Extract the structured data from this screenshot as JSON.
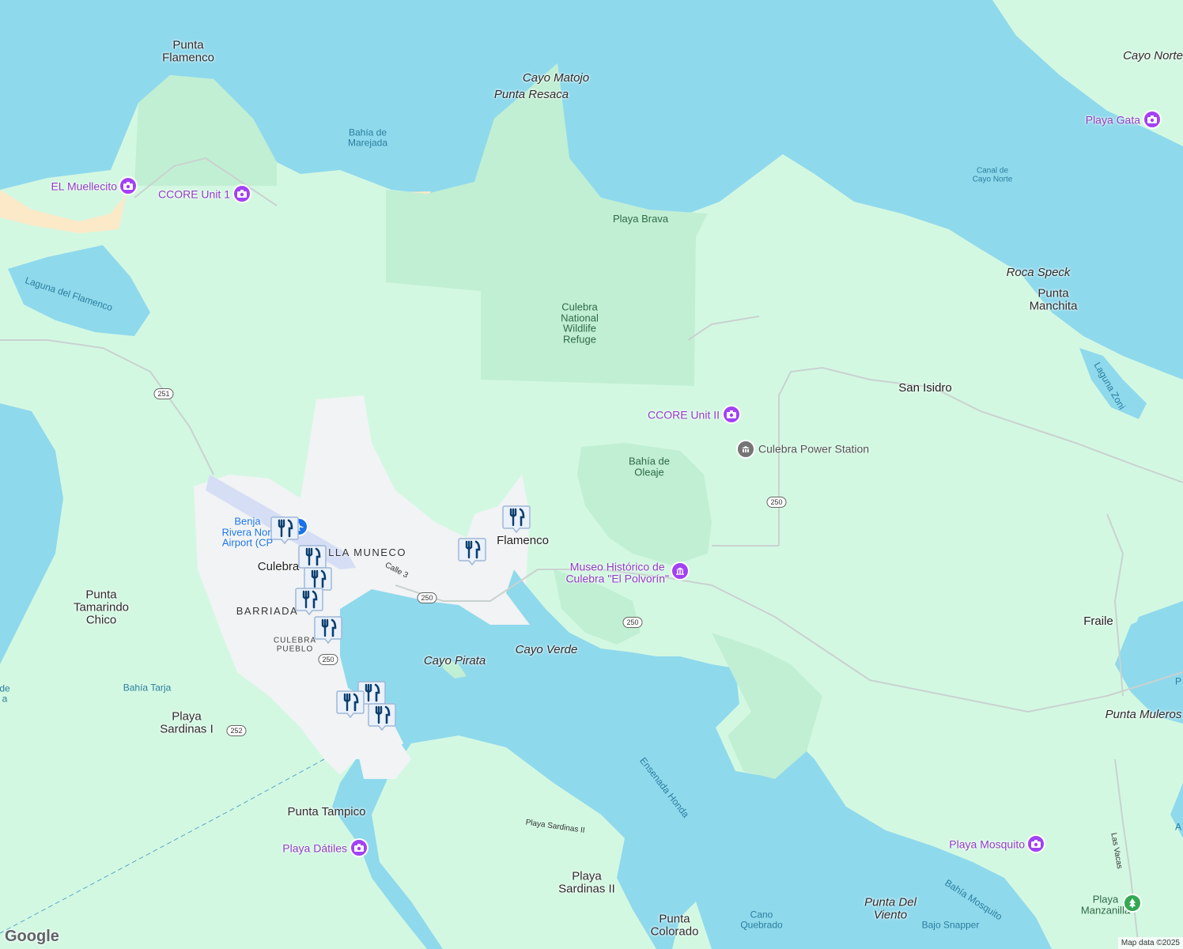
{
  "map": {
    "places": [
      {
        "id": "punta-flamenco",
        "text": "Punta\nFlamenco",
        "style": "place"
      },
      {
        "id": "cayo-matojo",
        "text": "Cayo Matojo",
        "style": "place-i"
      },
      {
        "id": "punta-resaca",
        "text": "Punta Resaca",
        "style": "place-i"
      },
      {
        "id": "cayo-norte",
        "text": "Cayo Norte",
        "style": "place-i"
      },
      {
        "id": "roca-speck",
        "text": "Roca Speck",
        "style": "place-i"
      },
      {
        "id": "punta-manchita",
        "text": "Punta\nManchita",
        "style": "place"
      },
      {
        "id": "san-isidro",
        "text": "San Isidro",
        "style": "town"
      },
      {
        "id": "flamenco",
        "text": "Flamenco",
        "style": "town"
      },
      {
        "id": "culebra",
        "text": "Culebra",
        "style": "town"
      },
      {
        "id": "villa-muneco",
        "text": "ILLA MUNECO",
        "style": "hood"
      },
      {
        "id": "barriada",
        "text": "BARRIADA",
        "style": "hood"
      },
      {
        "id": "culebra-pueblo",
        "text": "CULEBRA\nPUEBLO",
        "style": "hood-sm"
      },
      {
        "id": "punta-tamarindo",
        "text": "Punta\nTamarindo\nChico",
        "style": "place"
      },
      {
        "id": "playa-sardinas-i",
        "text": "Playa\nSardinas I",
        "style": "place"
      },
      {
        "id": "cayo-pirata",
        "text": "Cayo Pirata",
        "style": "place-i"
      },
      {
        "id": "cayo-verde",
        "text": "Cayo Verde",
        "style": "place-i"
      },
      {
        "id": "fraile",
        "text": "Fraile",
        "style": "town"
      },
      {
        "id": "punta-muleros",
        "text": "Punta Muleros",
        "style": "place-i"
      },
      {
        "id": "punta-tampico",
        "text": "Punta Tampico",
        "style": "place"
      },
      {
        "id": "playa-sardinas-ii",
        "text": "Playa\nSardinas II",
        "style": "place"
      },
      {
        "id": "punta-colorado",
        "text": "Punta\nColorado",
        "style": "place"
      },
      {
        "id": "punta-del-viento",
        "text": "Punta Del\nViento",
        "style": "place-i"
      },
      {
        "id": "playa-manzanilla",
        "text": "Playa\nManzanilla",
        "style": "park"
      }
    ],
    "water_labels": [
      {
        "id": "bahia-marejada",
        "text": "Bahía de\nMarejada",
        "style": "water"
      },
      {
        "id": "canal-cayo-norte",
        "text": "Canal de\nCayo Norte",
        "style": "water-sm"
      },
      {
        "id": "laguna-flamenco",
        "text": "Laguna del Flamenco",
        "style": "water"
      },
      {
        "id": "laguna-zoni",
        "text": "Laguna Zoni",
        "style": "water"
      },
      {
        "id": "bahia-tarja",
        "text": "Bahía Tarja",
        "style": "water"
      },
      {
        "id": "ensenada-honda",
        "text": "Ensenada Honda",
        "style": "water"
      },
      {
        "id": "bahia-mosquito",
        "text": "Bahía Mosquito",
        "style": "water"
      },
      {
        "id": "bajo-snapper",
        "text": "Bajo Snapper",
        "style": "water"
      },
      {
        "id": "cano-quebrado",
        "text": "Cano\nQuebrado",
        "style": "water"
      },
      {
        "id": "left-de",
        "text": "de\na",
        "style": "water"
      },
      {
        "id": "right-a",
        "text": "A",
        "style": "water"
      },
      {
        "id": "right-p",
        "text": "P",
        "style": "water"
      }
    ],
    "park_labels": [
      {
        "id": "playa-brava",
        "text": "Playa Brava",
        "style": "park"
      },
      {
        "id": "culebra-nwr",
        "text": "Culebra\nNational\nWildlife\nRefuge",
        "style": "park"
      },
      {
        "id": "bahia-oleaje",
        "text": "Bahía de\nOleaje",
        "style": "park"
      }
    ],
    "street_labels": [
      {
        "id": "calle-3",
        "text": "Calle 3"
      },
      {
        "id": "playa-sardinas-ii-road",
        "text": "Playa Sardinas II"
      },
      {
        "id": "las-vacas",
        "text": "Las Vacas"
      }
    ],
    "route_shields": [
      {
        "id": "r251",
        "text": "251"
      },
      {
        "id": "r250a",
        "text": "250"
      },
      {
        "id": "r250b",
        "text": "250"
      },
      {
        "id": "r250c",
        "text": "250"
      },
      {
        "id": "r250d",
        "text": "250"
      },
      {
        "id": "r252",
        "text": "252"
      }
    ],
    "pois": [
      {
        "id": "el-muellecito",
        "text": "EL Muellecito",
        "icon": "camera-icon",
        "color": "#a142f4"
      },
      {
        "id": "ccore-unit-1",
        "text": "CCORE Unit 1",
        "icon": "camera-icon",
        "color": "#a142f4"
      },
      {
        "id": "playa-gata",
        "text": "Playa Gata",
        "icon": "camera-icon",
        "color": "#a142f4"
      },
      {
        "id": "ccore-unit-2",
        "text": "CCORE Unit II",
        "icon": "camera-icon",
        "color": "#a142f4"
      },
      {
        "id": "power-station",
        "text": "Culebra Power Station",
        "icon": "building-icon",
        "color": "#757575"
      },
      {
        "id": "museo",
        "text": "Museo Histórico de\nCulebra \"El Polvorín\"",
        "icon": "museum-icon",
        "color": "#a142f4"
      },
      {
        "id": "playa-datiles",
        "text": "Playa Dátiles",
        "icon": "camera-icon",
        "color": "#a142f4"
      },
      {
        "id": "playa-mosquito",
        "text": "Playa Mosquito",
        "icon": "camera-icon",
        "color": "#a142f4"
      },
      {
        "id": "airport",
        "text": "Benja\nRivera Nori\nAirport (CP",
        "icon": "airport-icon",
        "color": "#1a73e8"
      }
    ],
    "restaurant_pins": 10,
    "footer": {
      "logo": "Google",
      "attribution": "Map data ©2025"
    },
    "colors": {
      "water": "#8fd9ec",
      "land": "#d3f8e2",
      "park": "#c1efd3",
      "urban": "#f1f3f4",
      "beach": "#fbe9c8",
      "pin": "#0b3e6f"
    }
  }
}
